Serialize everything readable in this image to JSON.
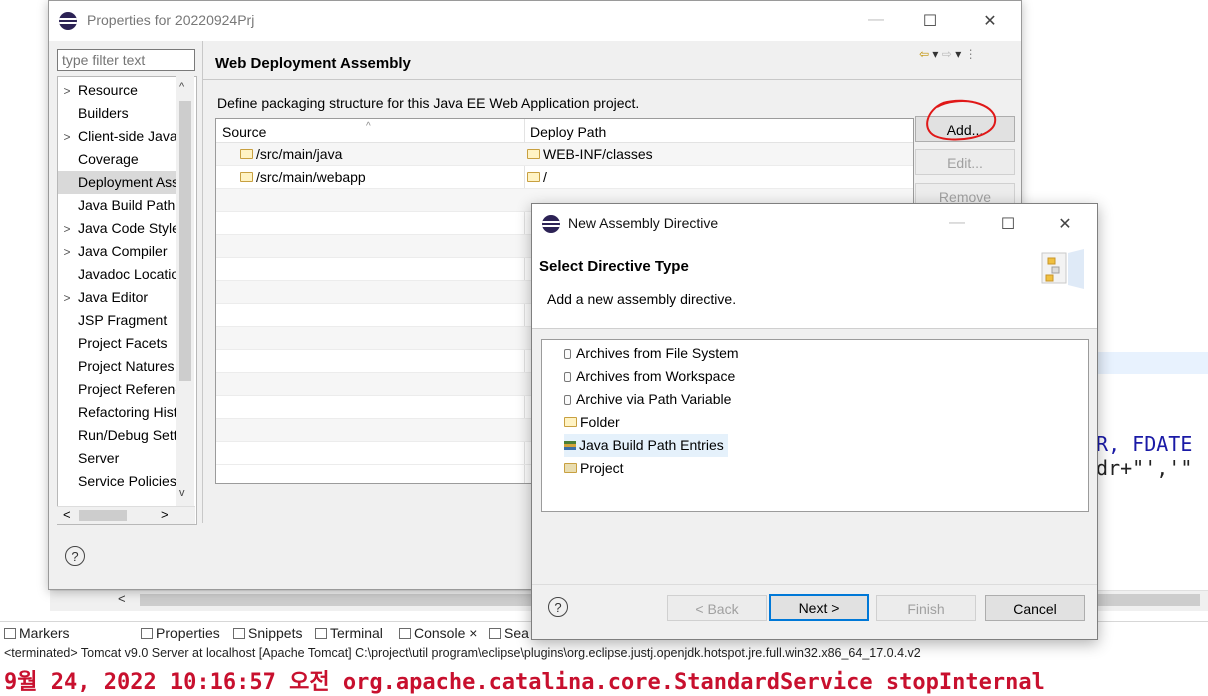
{
  "background": {
    "code_fragment_1": "DR, FDATE",
    "code_fragment_2": "ddr+\"','\"",
    "views": [
      {
        "label": "Markers",
        "icon": "markers-icon"
      },
      {
        "label": "Properties",
        "icon": "properties-icon"
      },
      {
        "label": "Snippets",
        "icon": "snippets-icon"
      },
      {
        "label": "Terminal",
        "icon": "terminal-icon"
      },
      {
        "label": "Console",
        "icon": "console-icon"
      },
      {
        "label": "Sea",
        "icon": "search-icon"
      }
    ],
    "console_close": "×",
    "console_header": "<terminated> Tomcat v9.0 Server at localhost [Apache Tomcat] C:\\project\\util program\\eclipse\\plugins\\org.eclipse.justj.openjdk.hotspot.jre.full.win32.x86_64_17.0.4.v2",
    "console_line": "9월 24, 2022 10:16:57 오전 org.apache.catalina.core.StandardService stopInternal"
  },
  "properties": {
    "title": "Properties for 20220924Prj",
    "filter_placeholder": "type filter text",
    "tree": [
      {
        "label": "Resource",
        "expandable": true
      },
      {
        "label": "Builders",
        "expandable": false
      },
      {
        "label": "Client-side JavaScript",
        "expandable": true
      },
      {
        "label": "Coverage",
        "expandable": false
      },
      {
        "label": "Deployment Assembly",
        "expandable": false,
        "selected": true
      },
      {
        "label": "Java Build Path",
        "expandable": false
      },
      {
        "label": "Java Code Style",
        "expandable": true
      },
      {
        "label": "Java Compiler",
        "expandable": true
      },
      {
        "label": "Javadoc Location",
        "expandable": false
      },
      {
        "label": "Java Editor",
        "expandable": true
      },
      {
        "label": "JSP Fragment",
        "expandable": false
      },
      {
        "label": "Project Facets",
        "expandable": false
      },
      {
        "label": "Project Natures",
        "expandable": false
      },
      {
        "label": "Project References",
        "expandable": false
      },
      {
        "label": "Refactoring History",
        "expandable": false
      },
      {
        "label": "Run/Debug Settings",
        "expandable": false
      },
      {
        "label": "Server",
        "expandable": false
      },
      {
        "label": "Service Policies",
        "expandable": false
      }
    ],
    "page_title": "Web Deployment Assembly",
    "page_description": "Define packaging structure for this Java EE Web Application project.",
    "table": {
      "headers": [
        "Source",
        "Deploy Path"
      ],
      "rows": [
        {
          "source": "/src/main/java",
          "deploy": "WEB-INF/classes"
        },
        {
          "source": "/src/main/webapp",
          "deploy": "/"
        }
      ]
    },
    "buttons": {
      "add": "Add...",
      "edit": "Edit...",
      "remove": "Remove"
    },
    "help": "?"
  },
  "dialog": {
    "title": "New Assembly Directive",
    "heading": "Select Directive Type",
    "description": "Add a new assembly directive.",
    "items": [
      {
        "label": "Archives from File System",
        "icon": "jar-icon"
      },
      {
        "label": "Archives from Workspace",
        "icon": "jar-icon"
      },
      {
        "label": "Archive via Path Variable",
        "icon": "jar-icon"
      },
      {
        "label": "Folder",
        "icon": "folder-icon"
      },
      {
        "label": "Java Build Path Entries",
        "icon": "library-icon",
        "selected": true
      },
      {
        "label": "Project",
        "icon": "project-icon"
      }
    ],
    "buttons": {
      "back": "< Back",
      "next": "Next >",
      "finish": "Finish",
      "cancel": "Cancel"
    },
    "help": "?"
  }
}
